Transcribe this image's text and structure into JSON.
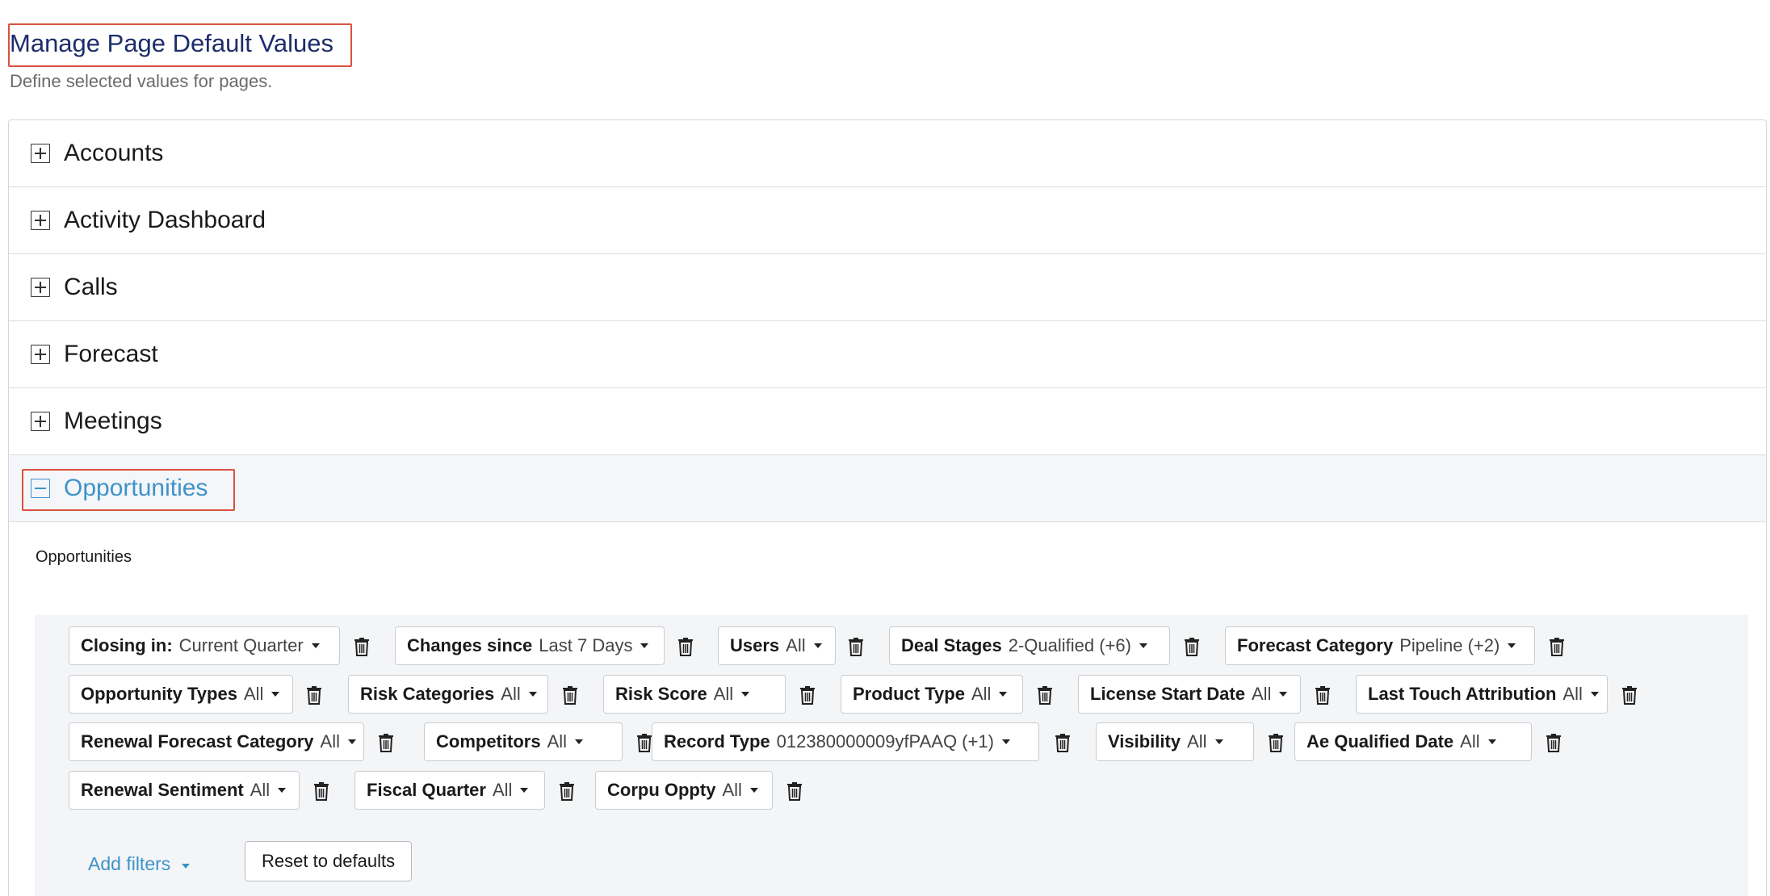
{
  "header": {
    "title": "Manage Page Default Values",
    "subtitle": "Define selected values for pages."
  },
  "accordion": {
    "sections": [
      {
        "label": "Accounts",
        "expanded": false
      },
      {
        "label": "Activity Dashboard",
        "expanded": false
      },
      {
        "label": "Calls",
        "expanded": false
      },
      {
        "label": "Forecast",
        "expanded": false
      },
      {
        "label": "Meetings",
        "expanded": false
      },
      {
        "label": "Opportunities",
        "expanded": true
      }
    ]
  },
  "opportunities": {
    "heading": "Opportunities",
    "filters": [
      {
        "name": "Closing in:",
        "value": "Current Quarter"
      },
      {
        "name": "Changes since",
        "value": "Last 7 Days"
      },
      {
        "name": "Users",
        "value": "All"
      },
      {
        "name": "Deal Stages",
        "value": "2-Qualified (+6)"
      },
      {
        "name": "Forecast Category",
        "value": "Pipeline (+2)"
      },
      {
        "name": "Opportunity Types",
        "value": "All"
      },
      {
        "name": "Risk Categories",
        "value": "All"
      },
      {
        "name": "Risk Score",
        "value": "All"
      },
      {
        "name": "Product Type",
        "value": "All"
      },
      {
        "name": "License Start Date",
        "value": "All"
      },
      {
        "name": "Last Touch Attribution",
        "value": "All"
      },
      {
        "name": "Renewal Forecast Category",
        "value": "All"
      },
      {
        "name": "Competitors",
        "value": "All"
      },
      {
        "name": "Record Type",
        "value": "012380000009yfPAAQ (+1)"
      },
      {
        "name": "Visibility",
        "value": "All"
      },
      {
        "name": "Ae Qualified Date",
        "value": "All"
      },
      {
        "name": "Renewal Sentiment",
        "value": "All"
      },
      {
        "name": "Fiscal Quarter",
        "value": "All"
      },
      {
        "name": "Corpu Oppty",
        "value": "All"
      }
    ],
    "add_filters_label": "Add filters",
    "reset_label": "Reset to defaults"
  },
  "icons": {
    "expand": "plus-square-icon",
    "collapse": "minus-square-icon",
    "remove": "trash-icon",
    "dropdown": "caret-down-icon"
  },
  "colors": {
    "title": "#1d2d6b",
    "accent": "#3e93c9",
    "highlight_border": "#d9533f",
    "filter_bg": "#f4f5f7"
  }
}
